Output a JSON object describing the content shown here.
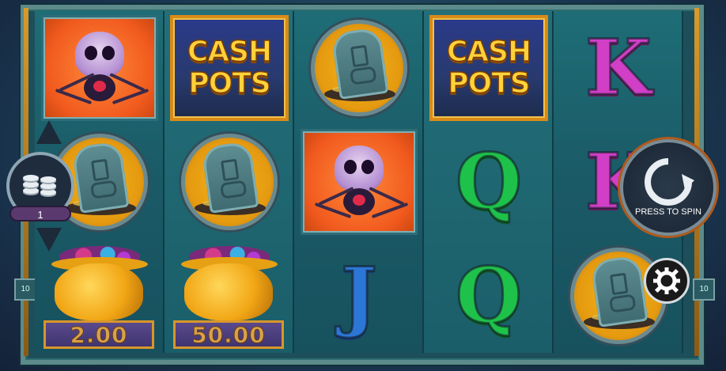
{
  "reels": [
    [
      "spider",
      "tombstone",
      "pot"
    ],
    [
      "cash_pots",
      "tombstone",
      "pot"
    ],
    [
      "tombstone",
      "spider",
      "J"
    ],
    [
      "cash_pots",
      "Q",
      "Q"
    ],
    [
      "K",
      "K",
      "tombstone"
    ]
  ],
  "cash_pots_text": [
    "CASH",
    "POTS"
  ],
  "letters": {
    "K": "K",
    "Q": "Q",
    "J": "J"
  },
  "pot_values": [
    "2.00",
    "50.00"
  ],
  "bet": {
    "value": "1"
  },
  "spin": {
    "label": "PRESS TO SPIN"
  },
  "side_emblem": "10",
  "colors": {
    "spider_bg": "#f15a1e",
    "cash_text": "#ffd23a",
    "K": "#d23fc7",
    "Q": "#1ec24a",
    "J": "#2c77d6",
    "gold": "#f2a716"
  },
  "icons": {
    "settings": "gear-icon",
    "spin": "spin-arrow-icon",
    "bet": "coin-stack-icon"
  }
}
